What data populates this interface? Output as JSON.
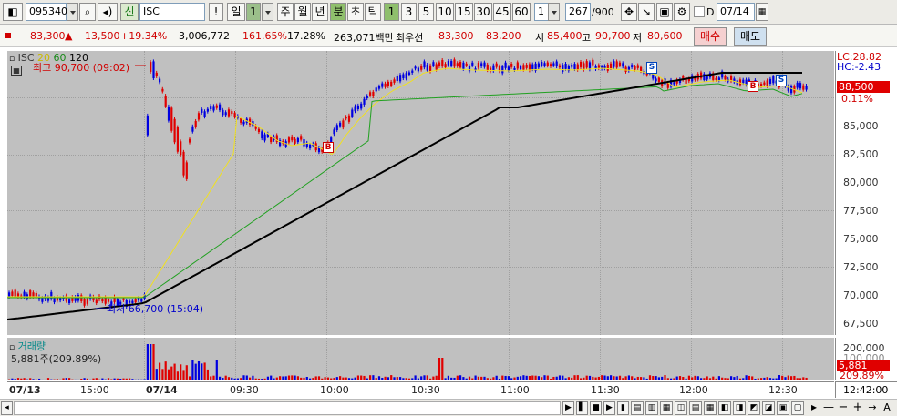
{
  "toolbar": {
    "code": "095340",
    "name": "ISC",
    "type_badge": "신",
    "periods": [
      "일",
      "1",
      "주",
      "월",
      "년",
      "분",
      "초",
      "틱"
    ],
    "minutes": [
      "1",
      "3",
      "5",
      "10",
      "15",
      "30",
      "45",
      "60"
    ],
    "interval": "1",
    "count": "267",
    "total": "/900",
    "date": "07/14",
    "d_label": "D",
    "exclaim": "!"
  },
  "quote": {
    "price": "83,300",
    "arrow": "▲",
    "change": "13,500",
    "change_pct": "+19.34%",
    "volume": "3,006,772",
    "vol_ratio": "161.65%",
    "turnover": "17.28%",
    "amount": "263,071백만",
    "best_label": "최우선",
    "ask": "83,300",
    "bid": "83,200",
    "open_label": "시",
    "open": "85,400",
    "high_label": "고",
    "high": "90,700",
    "low_label": "저",
    "low": "80,600",
    "buy": "매수",
    "sell": "매도"
  },
  "legend": {
    "name": "ISC",
    "ma20": "20",
    "ma60": "60",
    "ma120": "120"
  },
  "annotations": {
    "high": "최고 90,700 (09:02)",
    "low": "최저 66,700 (15:04)",
    "buy1": "B",
    "buy2": "B",
    "sell1": "S",
    "sell2": "S"
  },
  "right_panel": {
    "lc": "LC:28.82",
    "hc": "HC:-2.43",
    "price_badge": "88,500",
    "pct_badge": "0.11%",
    "vol_badge": "5,881",
    "vol_pct": "209.89%",
    "vol_top": "200,000",
    "vol_mid": "100,000"
  },
  "volume_legend": {
    "title": "거래량",
    "value": "5,881주(209.89%)"
  },
  "y_ticks": [
    "85,000",
    "82,500",
    "80,000",
    "77,500",
    "75,000",
    "72,500",
    "70,000",
    "67,500"
  ],
  "x_ticks": [
    "07/13",
    "15:00",
    "07/14",
    "09:30",
    "10:00",
    "10:30",
    "11:00",
    "11:30",
    "12:00",
    "12:30"
  ],
  "clock": "12:42:00",
  "colors": {
    "up": "#e00000",
    "down": "#0000e0",
    "ma20": "#f0e020",
    "ma60": "#20a020",
    "ma120": "#000000",
    "plot_bg": "#c0c0c0"
  }
}
